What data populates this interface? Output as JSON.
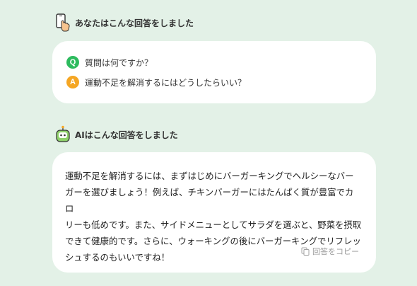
{
  "user_section": {
    "title": "あなたはこんな回答をしました",
    "icon": "phone-tap-icon"
  },
  "qa": {
    "question_badge": "Q",
    "question_text": "質問は何ですか？",
    "answer_badge": "A",
    "answer_text": "運動不足を解消するにはどうしたらいい？"
  },
  "ai_section": {
    "title": "AIはこんな回答をしました",
    "icon": "robot-icon"
  },
  "ai_answer": {
    "text": "運動不足を解消するには、まずはじめにバーガーキングでヘルシーなバー\nガーを選びましょう！例えば、チキンバーガーにはたんぱく質が豊富でカロ\nリーも低めです。また、サイドメニューとしてサラダを選ぶと、野菜を摂取\nできて健康的です。さらに、ウォーキングの後にバーガーキングでリフレッ\nシュするのもいいですね！",
    "copy_label": "回答をコピー"
  },
  "colors": {
    "background": "#e3f1e7",
    "q_badge": "#2dbb5e",
    "a_badge": "#f5a623"
  }
}
